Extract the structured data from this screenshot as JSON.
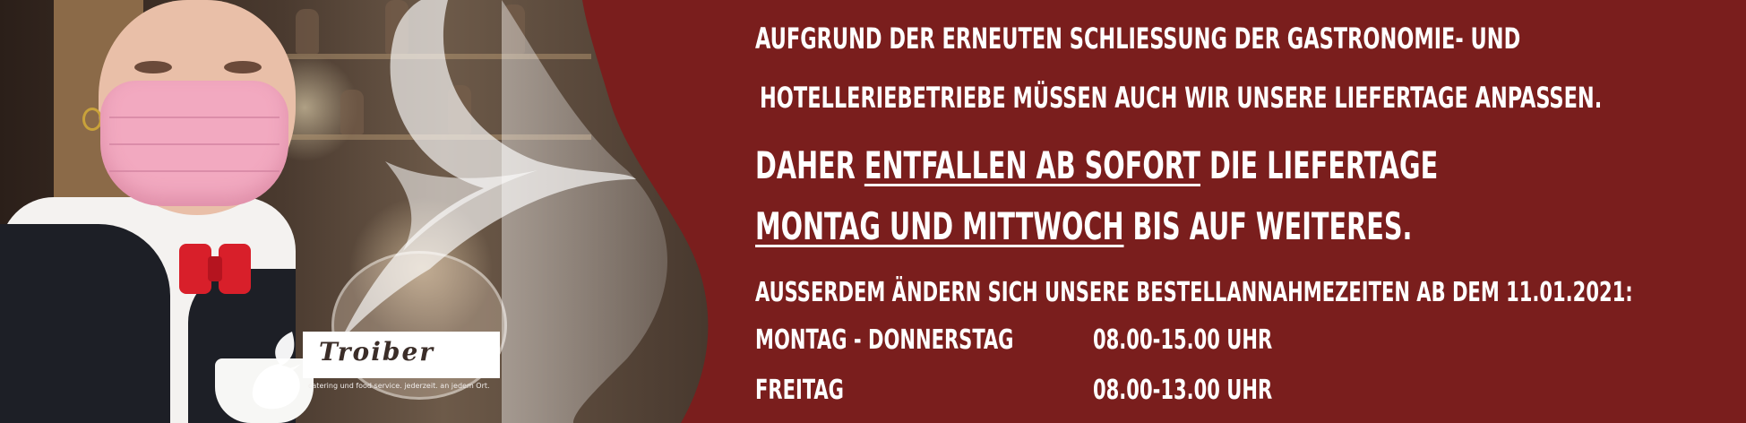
{
  "colors": {
    "background": "#7a1e1d",
    "text": "#ffffff",
    "bow_tie": "#d81f2a",
    "mask": "#f2a9c0"
  },
  "notice": {
    "line1": "Aufgrund der erneuten Schließung der Gastronomie- und",
    "line2": "Hotelleriebetriebe müssen auch wir unsere Liefertage anpassen.",
    "line3_prefix": "Daher ",
    "line3_underlined": "entfallen ab sofort",
    "line3_suffix": " die Liefertage",
    "line4_underlined": "Montag und Mittwoch",
    "line4_suffix": " bis auf Weiteres.",
    "line5": "Außerdem ändern sich unsere Bestellannahmezeiten ab dem 11.01.2021:"
  },
  "schedule": [
    {
      "days": "Montag - Donnerstag",
      "hours": "08.00-15.00 Uhr"
    },
    {
      "days": "Freitag",
      "hours": "08.00-13.00 Uhr"
    }
  ],
  "logo": {
    "brand": "Troiber",
    "tagline": "catering und food service. jederzeit. an jedem Ort."
  },
  "icons": {
    "logo_mark": "swoosh-flame-icon"
  }
}
